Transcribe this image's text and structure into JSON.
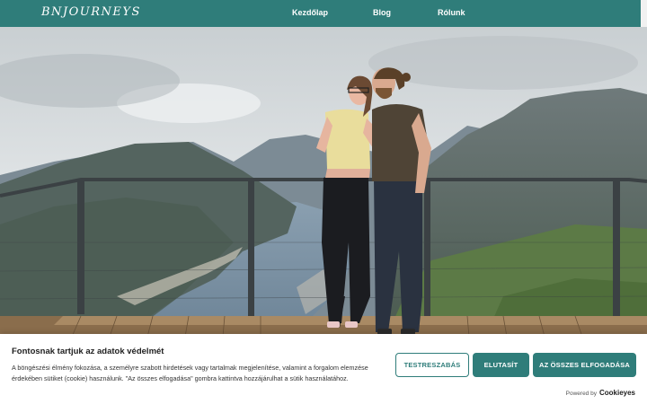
{
  "navbar": {
    "logo": "BNJOURNEYS",
    "items": [
      {
        "label": "Kezdőlap"
      },
      {
        "label": "Blog"
      },
      {
        "label": "Rólunk"
      }
    ]
  },
  "cookie": {
    "title": "Fontosnak tartjuk az adatok védelmét",
    "text": "A böngészési élmény fokozása, a személyre szabott hirdetések vagy tartalmak megjelenítése, valamint a forgalom elemzése érdekében sütiket (cookie) használunk. \"Az összes elfogadása\" gombra kattintva hozzájárulhat a sütik használatához.",
    "buttons": {
      "customize": "TESTRESZABÁS",
      "reject": "ELUTASÍT",
      "accept_all": "AZ ÖSSZES ELFOGADÁSA"
    },
    "powered_by": "Powered by",
    "powered_brand": "Cookieyes"
  },
  "colors": {
    "accent": "#2f7d7a"
  }
}
